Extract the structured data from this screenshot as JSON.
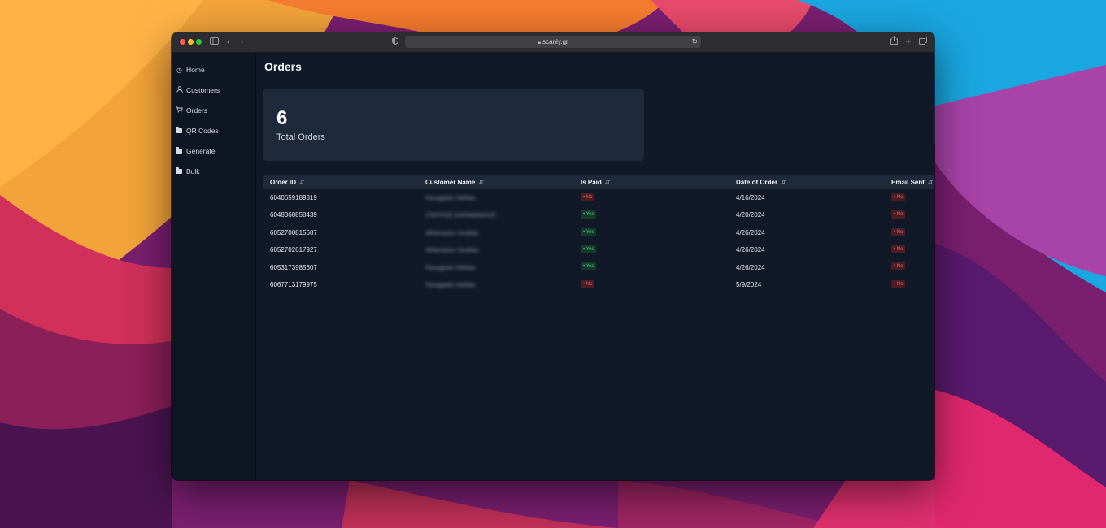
{
  "browser": {
    "url": "scanly.gr"
  },
  "sidebar": {
    "items": [
      {
        "label": "Home",
        "icon": "clock-icon"
      },
      {
        "label": "Customers",
        "icon": "user-icon"
      },
      {
        "label": "Orders",
        "icon": "cart-icon"
      },
      {
        "label": "QR Codes",
        "icon": "folder-icon"
      },
      {
        "label": "Generate",
        "icon": "folder-icon"
      },
      {
        "label": "Bulk",
        "icon": "folder-icon"
      }
    ]
  },
  "page": {
    "title": "Orders"
  },
  "stats": {
    "total_value": "6",
    "total_label": "Total Orders"
  },
  "table": {
    "headers": [
      "Order ID",
      "Customer Name",
      "Is Paid",
      "Date of Order",
      "Email Sent"
    ],
    "rows": [
      {
        "order_id": "6040659189319",
        "customer": "Panagiotis Vlahlas",
        "paid": "No",
        "date": "4/16/2024",
        "email": "No"
      },
      {
        "order_id": "6048368858439",
        "customer": "ΣΤΑΥΡΟΣ ΚΑΡΑΜΑΝΛΗΣ",
        "paid": "Yes",
        "date": "4/20/2024",
        "email": "No"
      },
      {
        "order_id": "6052700815687",
        "customer": "Athanasios Voulitas",
        "paid": "Yes",
        "date": "4/26/2024",
        "email": "No"
      },
      {
        "order_id": "6052702617927",
        "customer": "Athanasios Voulitas",
        "paid": "Yes",
        "date": "4/26/2024",
        "email": "No"
      },
      {
        "order_id": "6053173985607",
        "customer": "Panagiotis Vlahlas",
        "paid": "Yes",
        "date": "4/26/2024",
        "email": "No"
      },
      {
        "order_id": "6067713179975",
        "customer": "Panagiotis Vlahlas",
        "paid": "No",
        "date": "5/9/2024",
        "email": "No"
      }
    ]
  },
  "colors": {
    "badge_no_bg": "#4a1c24",
    "badge_no_text": "#e0606d",
    "badge_yes_bg": "#143a2a",
    "badge_yes_text": "#47c884",
    "app_bg": "#111827",
    "card_bg": "#1e293b"
  }
}
